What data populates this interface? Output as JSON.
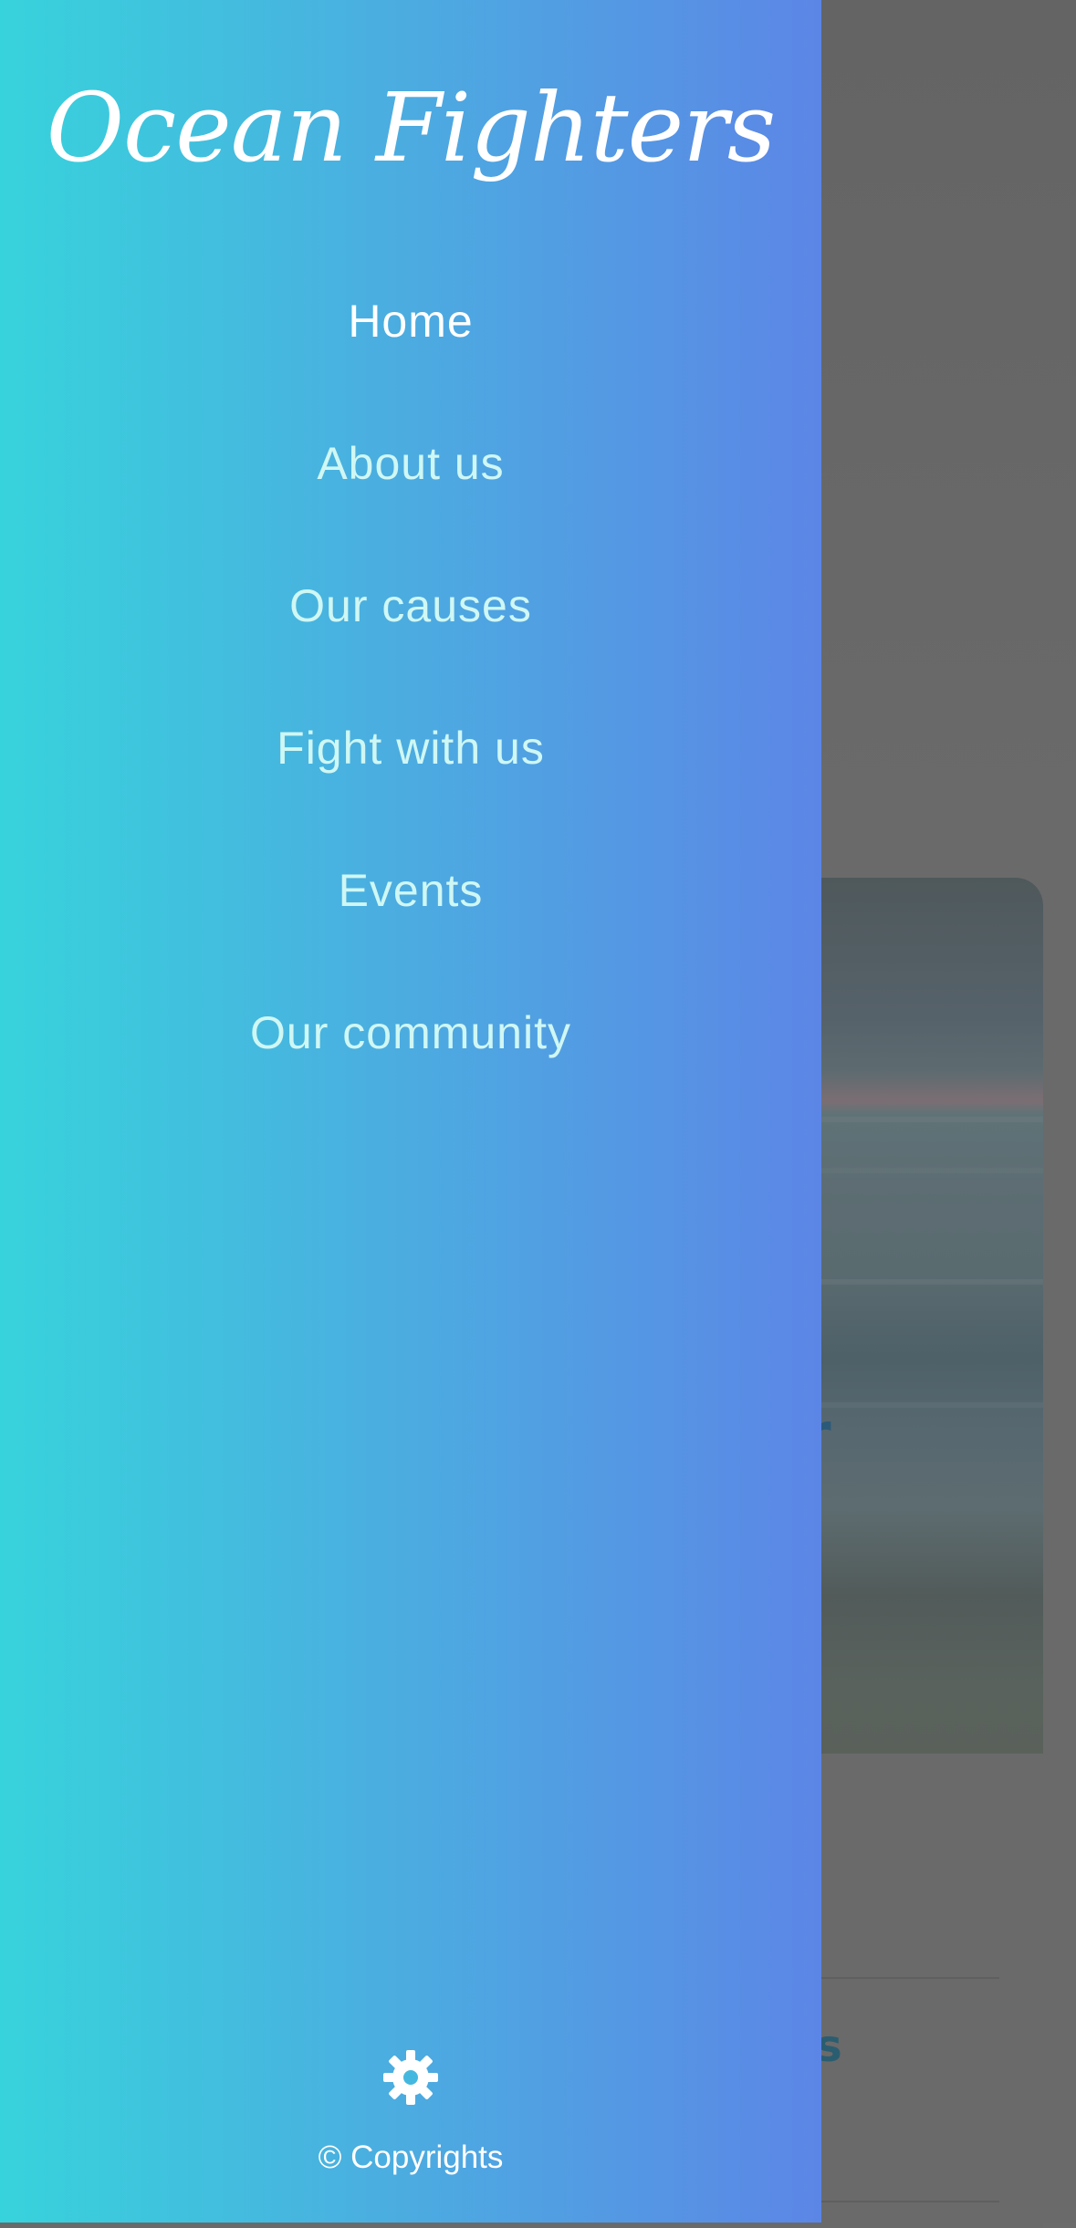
{
  "drawer": {
    "brand": "Ocean Fighters",
    "nav": [
      {
        "label": "Home",
        "active": true
      },
      {
        "label": "About us",
        "active": false
      },
      {
        "label": "Our causes",
        "active": false
      },
      {
        "label": "Fight with us",
        "active": false
      },
      {
        "label": "Events",
        "active": false
      },
      {
        "label": "Our community",
        "active": false
      }
    ],
    "settings_icon": "gear-icon",
    "copyright": "© Copyrights"
  },
  "background_page": {
    "card_heading_fragment": "r",
    "section_heading_fragment": "ns"
  },
  "colors": {
    "drawer_gradient_start": "#37d3dc",
    "drawer_gradient_end": "#5c86e6",
    "nav_text": "#cff7f4",
    "nav_text_active": "#ffffff",
    "overlay": "#6a6a6a"
  }
}
